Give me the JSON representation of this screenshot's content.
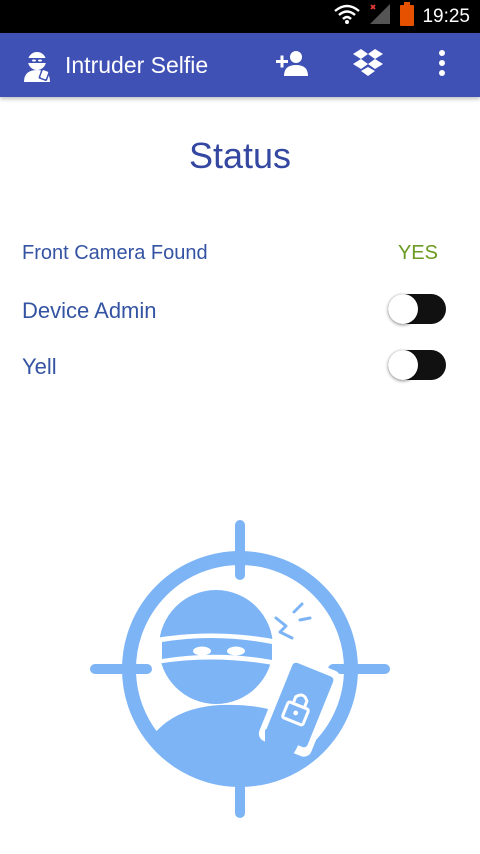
{
  "status_bar": {
    "time": "19:25",
    "icons": [
      "wifi-icon",
      "cellular-signal-icon",
      "battery-icon"
    ]
  },
  "app_bar": {
    "title": "Intruder Selfie",
    "background_color": "#3f51b5",
    "actions": [
      "add-contact-icon",
      "dropbox-icon",
      "overflow-menu-icon"
    ]
  },
  "main": {
    "heading": "Status",
    "rows": [
      {
        "label": "Front Camera Found",
        "value": "YES",
        "value_color": "#6a9a1f"
      },
      {
        "label": "Device Admin",
        "toggle_on": false
      },
      {
        "label": "Yell",
        "toggle_on": false
      }
    ],
    "illustration": "intruder-target-icon",
    "illustration_color": "#7cb4f6"
  }
}
